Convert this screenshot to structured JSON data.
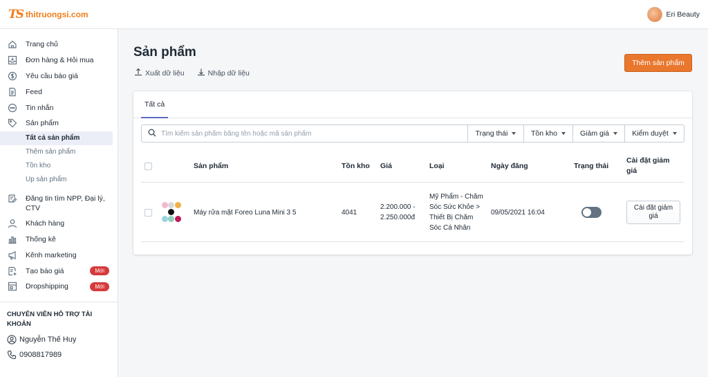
{
  "brand": {
    "logo_mark": "TS",
    "logo_text": "thitruongsi.com",
    "accent": "#f07d1a"
  },
  "user": {
    "name": "Eri Beauty"
  },
  "sidebar": {
    "items": [
      {
        "label": "Trang chủ",
        "icon": "home-icon"
      },
      {
        "label": "Đơn hàng & Hỏi mua",
        "icon": "inbox-icon"
      },
      {
        "label": "Yêu cầu báo giá",
        "icon": "dollar-icon"
      },
      {
        "label": "Feed",
        "icon": "document-icon"
      },
      {
        "label": "Tin nhắn",
        "icon": "chat-icon"
      },
      {
        "label": "Sản phẩm",
        "icon": "tag-icon"
      }
    ],
    "sub_items": [
      {
        "label": "Tất cả sản phẩm",
        "active": true
      },
      {
        "label": "Thêm sản phẩm"
      },
      {
        "label": "Tồn kho"
      },
      {
        "label": "Up sản phẩm"
      }
    ],
    "items2": [
      {
        "label": "Đăng tin tìm NPP, Đại lý, CTV",
        "icon": "post-icon"
      },
      {
        "label": "Khách hàng",
        "icon": "person-icon"
      },
      {
        "label": "Thống kê",
        "icon": "chart-icon"
      },
      {
        "label": "Kênh marketing",
        "icon": "megaphone-icon"
      },
      {
        "label": "Tạo báo giá",
        "icon": "quote-icon",
        "badge": "Mới"
      },
      {
        "label": "Dropshipping",
        "icon": "store-icon",
        "badge": "Mới"
      }
    ],
    "badge_color": "#d63a3a"
  },
  "support": {
    "title": "CHUYÊN VIÊN HỖ TRỢ TÀI KHOẢN",
    "name": "Nguyễn Thế Huy",
    "phone": "0908817989"
  },
  "main": {
    "title": "Sản phẩm",
    "export_label": "Xuất dữ liệu",
    "import_label": "Nhập dữ liệu",
    "add_button": "Thêm sản phẩm",
    "add_button_color": "#e9772d",
    "tabs": [
      {
        "label": "Tất cả"
      }
    ],
    "search_placeholder": "Tìm kiếm sản phẩm bằng tên hoặc mã sản phẩm",
    "filters": [
      "Trạng thái",
      "Tồn kho",
      "Giảm giá",
      "Kiểm duyệt"
    ]
  },
  "table": {
    "columns": [
      "Sản phẩm",
      "Tồn kho",
      "Giá",
      "Loại",
      "Ngày đăng",
      "Trạng thái",
      "Cài đặt giảm giá"
    ],
    "rows": [
      {
        "name": "Máy rửa mặt Foreo Luna Mini 3 5",
        "stock": "4041",
        "price": "2.200.000 - 2.250.000đ",
        "category": "Mỹ Phẩm - Chăm Sóc Sức Khỏe > Thiết Bị Chăm Sóc Cá Nhân",
        "date": "09/05/2021 16:04",
        "status_on": false,
        "discount_button": "Cài đặt giảm giá"
      }
    ]
  }
}
